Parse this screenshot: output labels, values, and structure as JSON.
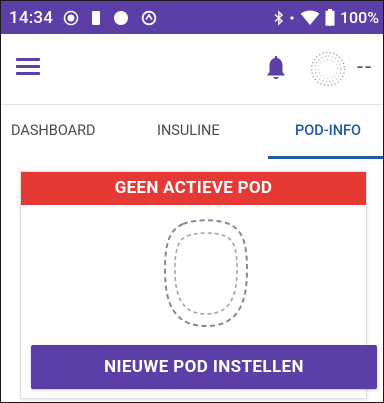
{
  "status_bar": {
    "time": "14:34",
    "battery_percent": "100%"
  },
  "app_bar": {
    "status_placeholder": "--"
  },
  "tabs": [
    {
      "label": "DASHBOARD",
      "active": false
    },
    {
      "label": "INSULINE",
      "active": false
    },
    {
      "label": "POD-INFO",
      "active": true
    }
  ],
  "pod_card": {
    "header": "GEEN ACTIEVE POD",
    "button_label": "NIEUWE POD INSTELLEN"
  },
  "colors": {
    "primary": "#5b3ea6",
    "alert": "#e53935",
    "tab_active": "#1f5aa6"
  }
}
